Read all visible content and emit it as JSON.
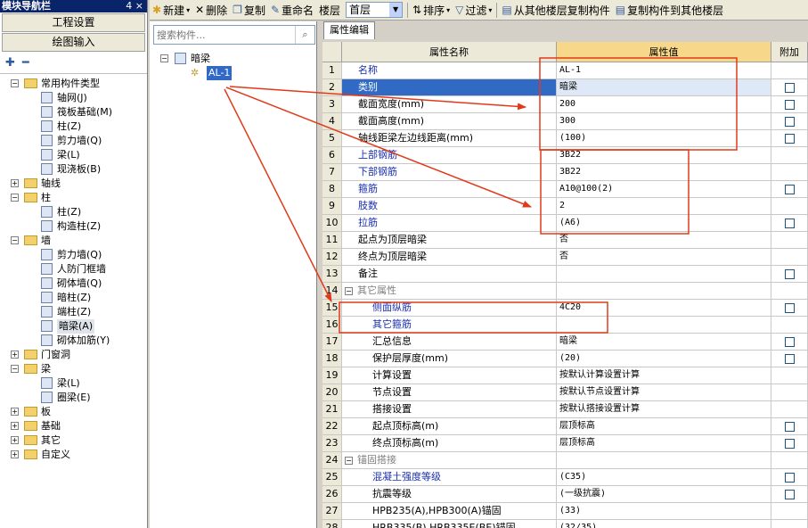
{
  "nav": {
    "title": "模块导航栏",
    "pin": "4 ×",
    "btn_project": "工程设置",
    "btn_draw": "绘图输入",
    "tree": [
      {
        "level": 0,
        "exp": "−",
        "folder": true,
        "label": "常用构件类型"
      },
      {
        "level": 1,
        "icon": "axis-grid-icon",
        "label": "轴网(J)"
      },
      {
        "level": 1,
        "icon": "raft-icon",
        "label": "筏板基础(M)"
      },
      {
        "level": 1,
        "icon": "column-icon",
        "label": "柱(Z)"
      },
      {
        "level": 1,
        "icon": "shear-wall-icon",
        "label": "剪力墙(Q)"
      },
      {
        "level": 1,
        "icon": "beam-icon",
        "label": "梁(L)"
      },
      {
        "level": 1,
        "icon": "slab-icon",
        "label": "现浇板(B)"
      },
      {
        "level": 0,
        "exp": "+",
        "folder": true,
        "label": "轴线"
      },
      {
        "level": 0,
        "exp": "−",
        "folder": true,
        "label": "柱"
      },
      {
        "level": 1,
        "icon": "column-icon",
        "label": "柱(Z)"
      },
      {
        "level": 1,
        "icon": "constructional-column-icon",
        "label": "构造柱(Z)"
      },
      {
        "level": 0,
        "exp": "−",
        "folder": true,
        "label": "墙"
      },
      {
        "level": 1,
        "icon": "shear-wall-icon",
        "label": "剪力墙(Q)"
      },
      {
        "level": 1,
        "icon": "civil-defense-wall-icon",
        "label": "人防门框墙"
      },
      {
        "level": 1,
        "icon": "masonry-wall-icon",
        "label": "砌体墙(Q)"
      },
      {
        "level": 1,
        "icon": "hidden-column-icon",
        "label": "暗柱(Z)"
      },
      {
        "level": 1,
        "icon": "end-column-icon",
        "label": "端柱(Z)"
      },
      {
        "level": 1,
        "icon": "hidden-beam-icon",
        "label": "暗梁(A)",
        "selected": true
      },
      {
        "level": 1,
        "icon": "masonry-rebar-icon",
        "label": "砌体加筋(Y)"
      },
      {
        "level": 0,
        "exp": "+",
        "folder": true,
        "label": "门窗洞"
      },
      {
        "level": 0,
        "exp": "−",
        "folder": true,
        "label": "梁"
      },
      {
        "level": 1,
        "icon": "beam-icon",
        "label": "梁(L)"
      },
      {
        "level": 1,
        "icon": "ring-beam-icon",
        "label": "圈梁(E)"
      },
      {
        "level": 0,
        "exp": "+",
        "folder": true,
        "label": "板"
      },
      {
        "level": 0,
        "exp": "+",
        "folder": true,
        "label": "基础"
      },
      {
        "level": 0,
        "exp": "+",
        "folder": true,
        "label": "其它"
      },
      {
        "level": 0,
        "exp": "+",
        "folder": true,
        "label": "自定义"
      }
    ]
  },
  "toolbar": {
    "new": "新建",
    "delete": "删除",
    "copy": "复制",
    "rename": "重命名",
    "floor_label": "楼层",
    "floor_value": "首层",
    "sort": "排序",
    "filter": "过滤",
    "copy_from": "从其他楼层复制构件",
    "copy_to": "复制构件到其他楼层"
  },
  "components": {
    "search_placeholder": "搜索构件...",
    "root": "暗梁",
    "child": "AL-1"
  },
  "tab": {
    "label": "属性编辑"
  },
  "grid": {
    "headers": [
      "",
      "属性名称",
      "属性值",
      "附加"
    ],
    "rows": [
      {
        "n": "1",
        "name": "名称",
        "value": "AL-1",
        "blue": true,
        "chk": false
      },
      {
        "n": "2",
        "name": "类别",
        "value": "暗梁",
        "blue": true,
        "chk": true,
        "selected": true
      },
      {
        "n": "3",
        "name": "截面宽度(mm)",
        "value": "200",
        "blue": false,
        "chk": true
      },
      {
        "n": "4",
        "name": "截面高度(mm)",
        "value": "300",
        "blue": false,
        "chk": true
      },
      {
        "n": "5",
        "name": "轴线距梁左边线距离(mm)",
        "value": "(100)",
        "blue": false,
        "chk": true
      },
      {
        "n": "6",
        "name": "上部钢筋",
        "value": "3B22",
        "blue": true,
        "chk": false
      },
      {
        "n": "7",
        "name": "下部钢筋",
        "value": "3B22",
        "blue": true,
        "chk": false
      },
      {
        "n": "8",
        "name": "箍筋",
        "value": "A10@100(2)",
        "blue": true,
        "chk": true
      },
      {
        "n": "9",
        "name": "肢数",
        "value": "2",
        "blue": true,
        "chk": false
      },
      {
        "n": "10",
        "name": "拉筋",
        "value": "(A6)",
        "blue": true,
        "chk": true
      },
      {
        "n": "11",
        "name": "起点为顶层暗梁",
        "value": "否",
        "blue": false,
        "chk": false
      },
      {
        "n": "12",
        "name": "终点为顶层暗梁",
        "value": "否",
        "blue": false,
        "chk": false
      },
      {
        "n": "13",
        "name": "备注",
        "value": "",
        "blue": false,
        "chk": true
      },
      {
        "n": "14",
        "name": "其它属性",
        "value": "",
        "group": true
      },
      {
        "n": "15",
        "name": "侧面纵筋",
        "value": "4C20",
        "blue": true,
        "chk": true,
        "indent": true
      },
      {
        "n": "16",
        "name": "其它箍筋",
        "value": "",
        "blue": true,
        "chk": false,
        "indent": true
      },
      {
        "n": "17",
        "name": "汇总信息",
        "value": "暗梁",
        "blue": false,
        "chk": true,
        "indent": true
      },
      {
        "n": "18",
        "name": "保护层厚度(mm)",
        "value": "(20)",
        "blue": false,
        "chk": true,
        "indent": true
      },
      {
        "n": "19",
        "name": "计算设置",
        "value": "按默认计算设置计算",
        "blue": false,
        "chk": false,
        "indent": true
      },
      {
        "n": "20",
        "name": "节点设置",
        "value": "按默认节点设置计算",
        "blue": false,
        "chk": false,
        "indent": true
      },
      {
        "n": "21",
        "name": "搭接设置",
        "value": "按默认搭接设置计算",
        "blue": false,
        "chk": false,
        "indent": true
      },
      {
        "n": "22",
        "name": "起点顶标高(m)",
        "value": "层顶标高",
        "blue": false,
        "chk": true,
        "indent": true
      },
      {
        "n": "23",
        "name": "终点顶标高(m)",
        "value": "层顶标高",
        "blue": false,
        "chk": true,
        "indent": true
      },
      {
        "n": "24",
        "name": "锚固搭接",
        "value": "",
        "group": true
      },
      {
        "n": "25",
        "name": "混凝土强度等级",
        "value": "(C35)",
        "blue": true,
        "chk": true,
        "indent": true
      },
      {
        "n": "26",
        "name": "抗震等级",
        "value": "(一级抗震)",
        "blue": false,
        "chk": true,
        "indent": true
      },
      {
        "n": "27",
        "name": "HPB235(A),HPB300(A)锚固",
        "value": "(33)",
        "blue": false,
        "chk": false,
        "indent": true
      },
      {
        "n": "28",
        "name": "HRB335(B),HRB335E(BE)锚固",
        "value": "(32/35)",
        "blue": false,
        "chk": false,
        "indent": true
      }
    ]
  },
  "colors": {
    "annotation": "#e03a1a",
    "selection": "#316ac5",
    "header_value": "#f7d88a"
  }
}
